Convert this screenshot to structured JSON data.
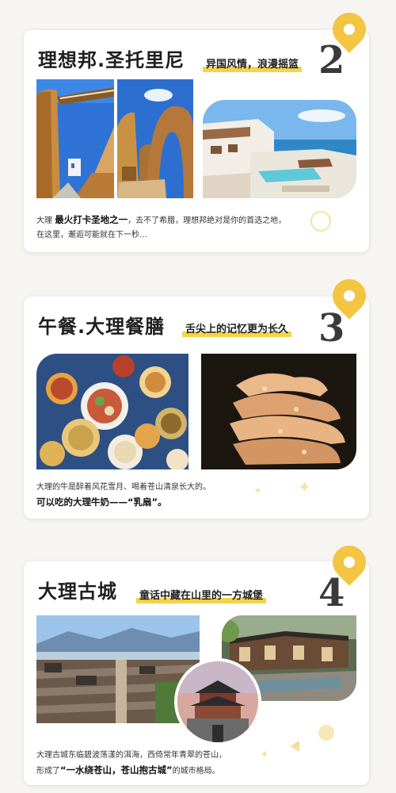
{
  "sections": [
    {
      "title": "理想邦.圣托里尼",
      "subtitle": "异国风情，浪漫摇篮",
      "number": "2",
      "text_line1_prefix": "大理",
      "text_line1_emphasis": "最火打卡圣地之一",
      "text_line1_suffix": "，去不了希腊，理想邦绝对是你的首选之地，",
      "text_line2": "在这里，邂逅可能就在下一秒…"
    },
    {
      "title": "午餐.大理餐膳",
      "subtitle": "舌尖上的记忆更为长久",
      "number": "3",
      "text_line1": "大理的牛是醉着风花雪月、喝着苍山清泉长大的。",
      "text_line2_emphasis": "可以吃的大理牛奶——“乳扇”。"
    },
    {
      "title": "大理古城",
      "subtitle": "童话中藏在山里的一方城堡",
      "number": "4",
      "text_line1": "大理古城东临碧波荡漾的洱海，西倚常年青翠的苍山，",
      "text_line2_prefix": "形成了",
      "text_line2_emphasis": "“一水绕苍山，苍山抱古城”",
      "text_line2_suffix": "的城市格局。"
    }
  ],
  "colors": {
    "accent_yellow": "#f4d44d",
    "pin_yellow": "#f4c542",
    "card_bg": "#ffffff",
    "page_bg": "#f7f5f1"
  },
  "icons": [
    "location-pin-icon",
    "sparkle-icon"
  ]
}
